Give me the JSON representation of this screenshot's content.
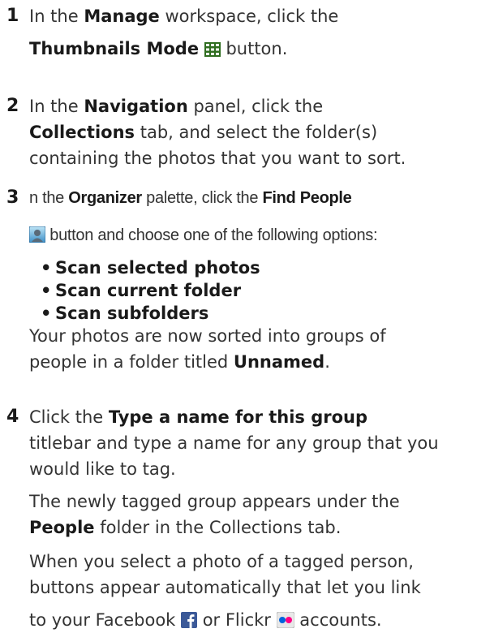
{
  "steps": [
    {
      "number": "1",
      "line1": {
        "a": "In the ",
        "b": "Manage",
        "c": " workspace, click the"
      },
      "line2": {
        "a": "Thumbnails Mode",
        "b": " button."
      }
    },
    {
      "number": "2",
      "line1": {
        "a": "In the ",
        "b": "Navigation",
        "c": " panel, click the"
      },
      "line2": {
        "a": "Collections",
        "b": " tab, and select the folder(s)"
      },
      "line3": "containing the photos that you want to sort."
    },
    {
      "number": "3",
      "line1": {
        "a": "n the ",
        "b": "Organizer",
        "c": " palette, click the ",
        "d": "Find People"
      },
      "line2": " button and choose one of the following options:",
      "options": [
        "Scan selected photos",
        "Scan current folder",
        "Scan subfolders"
      ],
      "after1": "Your photos are now sorted into groups of",
      "after2": {
        "a": "people in a folder titled ",
        "b": "Unnamed",
        "c": "."
      }
    },
    {
      "number": "4",
      "line1": {
        "a": "Click the ",
        "b": "Type a name for this group"
      },
      "line2": "titlebar and type a name for any group that you",
      "line3": "would like to tag.",
      "p2line1": "The newly tagged group appears under the",
      "p2line2": {
        "a": "People",
        "b": " folder in the Collections tab."
      },
      "p3line1": "When you select a photo of a tagged person,",
      "p3line2": "buttons appear automatically that let you link",
      "p3line3": {
        "a": "to your Facebook ",
        "b": " or Flickr ",
        "c": " accounts."
      }
    }
  ],
  "icons": {
    "thumbnails": "grid-icon",
    "find_people": "person-icon",
    "facebook": "facebook-icon",
    "flickr": "flickr-icon"
  },
  "colors": {
    "text": "#333333",
    "bold": "#1a1a1a",
    "facebook": "#3b5998",
    "flickr_pink": "#ff0084",
    "flickr_blue": "#0063dc"
  }
}
